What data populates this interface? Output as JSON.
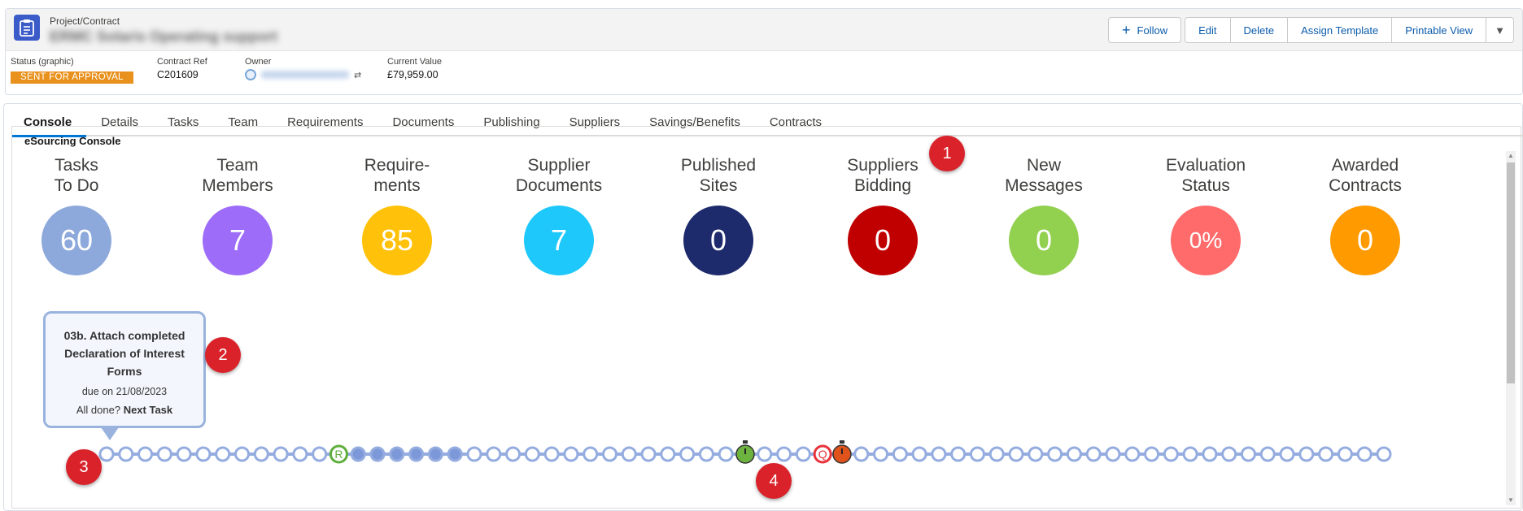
{
  "header": {
    "object_type": "Project/Contract",
    "record_name": "ERMC Solaris Operating support",
    "actions": {
      "follow": "Follow",
      "edit": "Edit",
      "delete": "Delete",
      "assign_template": "Assign Template",
      "printable_view": "Printable View",
      "more": "▼"
    },
    "fields": {
      "status_label": "Status (graphic)",
      "status_value": "SENT FOR APPROVAL",
      "contract_ref_label": "Contract Ref",
      "contract_ref_value": "C201609",
      "owner_label": "Owner",
      "current_value_label": "Current Value",
      "current_value_value": "£79,959.00"
    }
  },
  "tabs": [
    "Console",
    "Details",
    "Tasks",
    "Team",
    "Requirements",
    "Documents",
    "Publishing",
    "Suppliers",
    "Savings/Benefits",
    "Contracts"
  ],
  "console": {
    "title": "eSourcing Console",
    "metrics": [
      {
        "line1": "Tasks",
        "line2": "To Do",
        "value": "60",
        "color": "#8da9dc"
      },
      {
        "line1": "Team",
        "line2": "Members",
        "value": "7",
        "color": "#9d6cf8"
      },
      {
        "line1": "Require-",
        "line2": "ments",
        "value": "85",
        "color": "#ffc109"
      },
      {
        "line1": "Supplier",
        "line2": "Documents",
        "value": "7",
        "color": "#1ec8fb"
      },
      {
        "line1": "Published",
        "line2": "Sites",
        "value": "0",
        "color": "#1d2a6b"
      },
      {
        "line1": "Suppliers",
        "line2": "Bidding",
        "value": "0",
        "color": "#c00000"
      },
      {
        "line1": "New",
        "line2": "Messages",
        "value": "0",
        "color": "#92d050"
      },
      {
        "line1": "Evaluation",
        "line2": "Status",
        "value": "0%",
        "color": "#ff6b6b"
      },
      {
        "line1": "Awarded",
        "line2": "Contracts",
        "value": "0",
        "color": "#ff9a00"
      }
    ],
    "tooltip": {
      "title": "03b. Attach completed Declaration of Interest Forms",
      "due": "due on 21/08/2023",
      "prefix": "All done?",
      "link": "Next Task"
    },
    "timeline": {
      "node_count": 67,
      "filled_nodes": [
        13,
        14,
        15,
        16,
        17,
        18
      ],
      "r_marker_index": 12,
      "green_timer_index": 33,
      "q_marker_index": 37,
      "red_timer_index": 38,
      "r_label": "R",
      "q_label": "Q",
      "node_color": "#94acdf",
      "filled_color": "#7c98d8",
      "r_color": "#5fae3b",
      "q_color": "#e8333a",
      "green_timer_color": "#6db33f",
      "red_timer_color": "#e0541b"
    }
  },
  "markers": [
    "1",
    "2",
    "3",
    "4"
  ]
}
